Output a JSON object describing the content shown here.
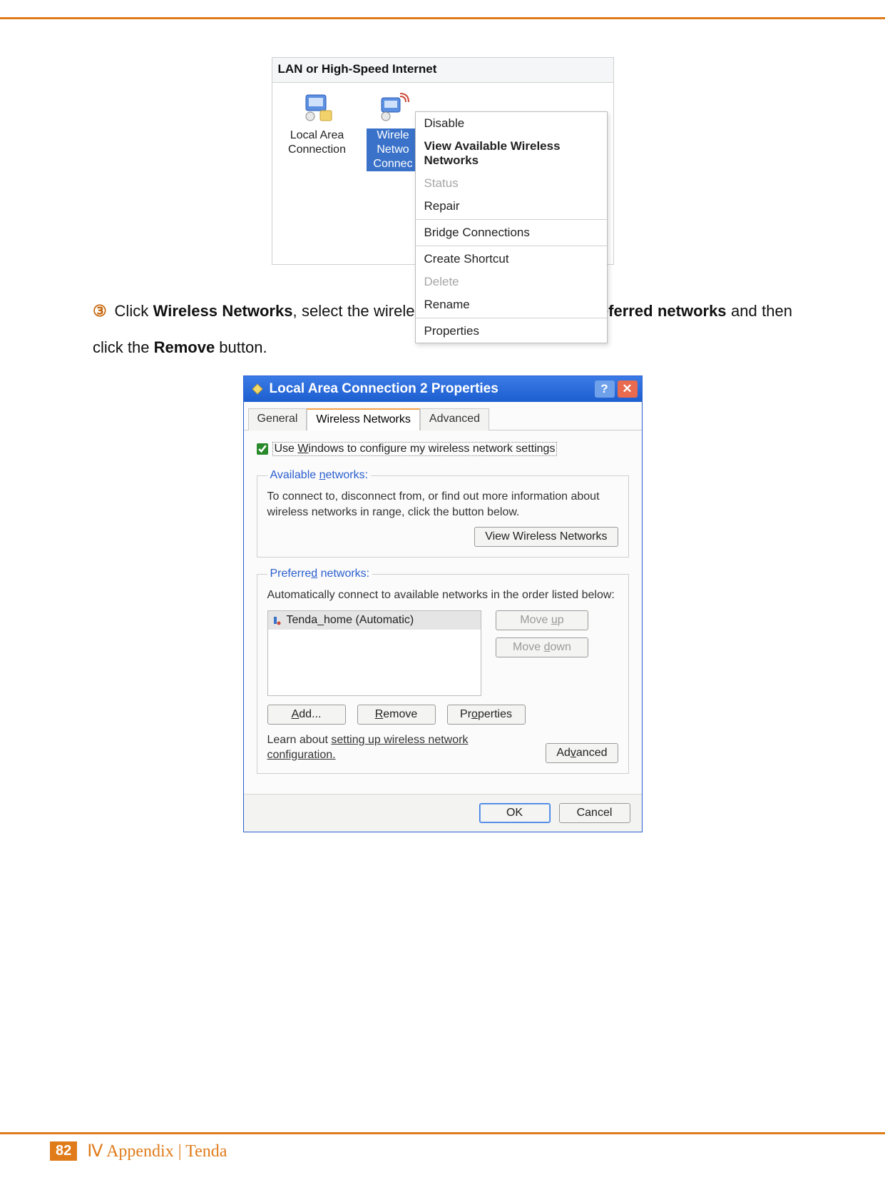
{
  "screenshot1": {
    "section_label": "LAN or High-Speed Internet",
    "conn1": {
      "line1": "Local Area",
      "line2": "Connection"
    },
    "conn2": {
      "line1": "Wirele",
      "line2": "Netwo",
      "line3": "Connec"
    },
    "context_menu": [
      {
        "label": "Disable",
        "type": "item"
      },
      {
        "label": "View Available Wireless Networks",
        "type": "bold"
      },
      {
        "label": "Status",
        "type": "disabled"
      },
      {
        "label": "Repair",
        "type": "item"
      },
      {
        "label": "",
        "type": "sep"
      },
      {
        "label": "Bridge Connections",
        "type": "item"
      },
      {
        "label": "",
        "type": "sep"
      },
      {
        "label": "Create Shortcut",
        "type": "item"
      },
      {
        "label": "Delete",
        "type": "disabled"
      },
      {
        "label": "Rename",
        "type": "item"
      },
      {
        "label": "",
        "type": "sep"
      },
      {
        "label": "Properties",
        "type": "item"
      }
    ]
  },
  "instruction": {
    "marker": "③",
    "text_parts": {
      "p1": " Click ",
      "b1": "Wireless Networks",
      "p2": ", select the wireless network name under ",
      "b2": "Preferred networks",
      "p3": " and then click the ",
      "b3": "Remove",
      "p4": " button."
    }
  },
  "dialog": {
    "title": "Local Area Connection 2 Properties",
    "help_glyph": "?",
    "close_glyph": "✕",
    "tabs": {
      "general": "General",
      "wireless": "Wireless Networks",
      "advanced": "Advanced"
    },
    "checkbox_label_pre": "Use ",
    "checkbox_label_u": "W",
    "checkbox_label_post": "indows to configure my wireless network settings",
    "available": {
      "legend_pre": "Available ",
      "legend_u": "n",
      "legend_post": "etworks:",
      "text": "To connect to, disconnect from, or find out more information about wireless networks in range, click the button below.",
      "btn": "View Wireless Networks"
    },
    "preferred": {
      "legend_pre": "Preferre",
      "legend_u": "d",
      "legend_post": " networks:",
      "text": "Automatically connect to available networks in the order listed below:",
      "item": "Tenda_home (Automatic)",
      "moveup_pre": "Move ",
      "moveup_u": "u",
      "moveup_post": "p",
      "movedown_pre": "Move ",
      "movedown_u": "d",
      "movedown_post": "own",
      "add_u": "A",
      "add_post": "dd...",
      "remove_u": "R",
      "remove_post": "emove",
      "props_pre": "Pr",
      "props_u": "o",
      "props_post": "perties"
    },
    "learn_pre": "Learn about ",
    "learn_link": "setting up wireless network configuration.",
    "adv_pre": "Ad",
    "adv_u": "v",
    "adv_post": "anced",
    "ok": "OK",
    "cancel": "Cancel"
  },
  "footer": {
    "page": "82",
    "text": "Ⅳ Appendix | Tenda"
  }
}
